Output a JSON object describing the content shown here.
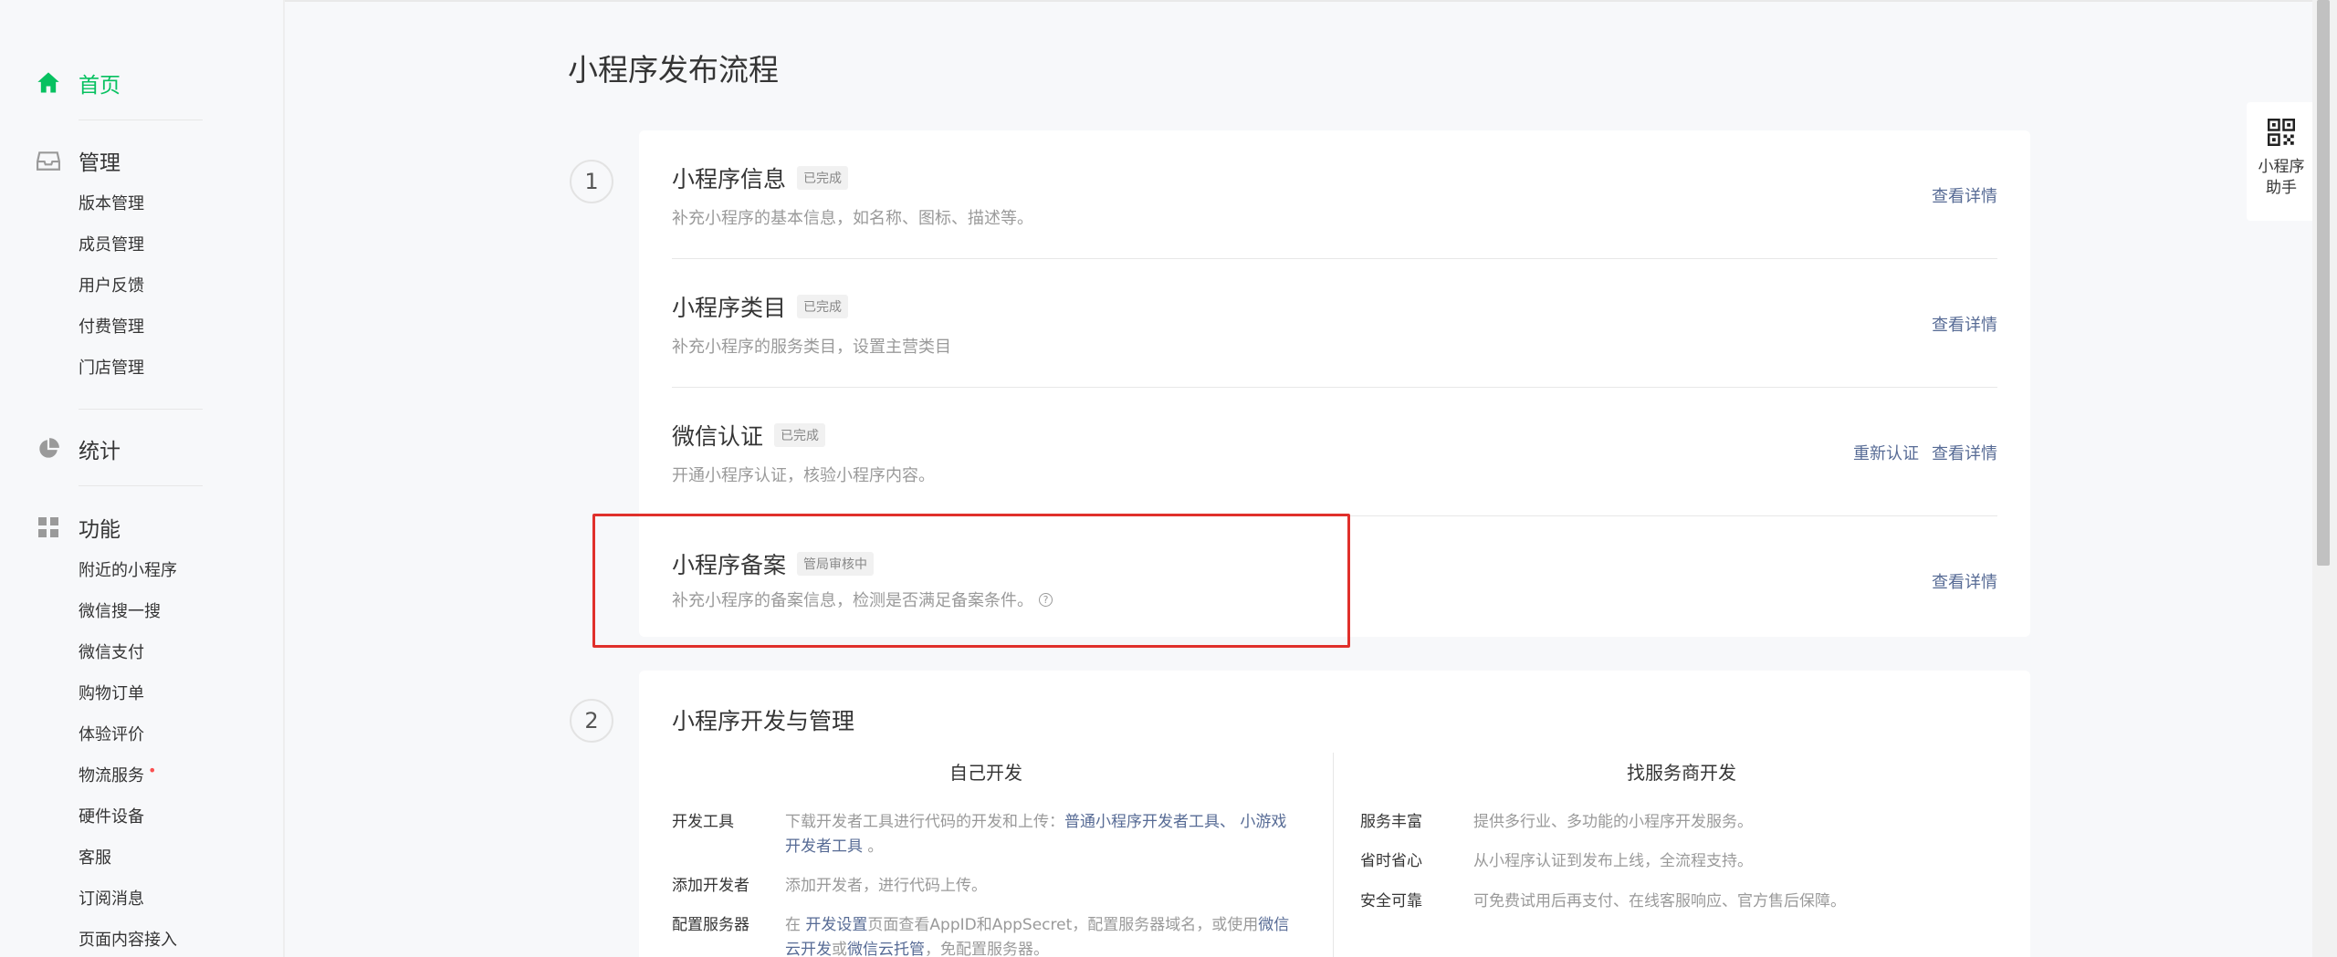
{
  "sidebar": {
    "home": {
      "label": "首页",
      "icon": "home-icon"
    },
    "manage": {
      "label": "管理",
      "icon": "inbox-icon",
      "items": [
        "版本管理",
        "成员管理",
        "用户反馈",
        "付费管理",
        "门店管理"
      ]
    },
    "stats": {
      "label": "统计",
      "icon": "pie-chart-icon"
    },
    "features": {
      "label": "功能",
      "icon": "grid-icon",
      "items": [
        "附近的小程序",
        "微信搜一搜",
        "微信支付",
        "购物订单",
        "体验评价",
        "物流服务",
        "硬件设备",
        "客服",
        "订阅消息",
        "页面内容接入"
      ],
      "new_dot": "•"
    }
  },
  "page": {
    "title": "小程序发布流程"
  },
  "step1": {
    "number": "1",
    "rows": [
      {
        "title": "小程序信息",
        "tag": "已完成",
        "desc": "补充小程序的基本信息，如名称、图标、描述等。",
        "links": [
          "查看详情"
        ]
      },
      {
        "title": "小程序类目",
        "tag": "已完成",
        "desc": "补充小程序的服务类目，设置主营类目",
        "links": [
          "查看详情"
        ]
      },
      {
        "title": "微信认证",
        "tag": "已完成",
        "desc": "开通小程序认证，核验小程序内容。",
        "links": [
          "重新认证",
          "查看详情"
        ]
      },
      {
        "title": "小程序备案",
        "tag": "管局审核中",
        "desc": "补充小程序的备案信息，检测是否满足备案条件。",
        "help": "?",
        "links": [
          "查看详情"
        ]
      }
    ]
  },
  "step2": {
    "number": "2",
    "title": "小程序开发与管理",
    "self_dev": {
      "heading": "自己开发",
      "items": [
        {
          "k": "开发工具",
          "v1": "下载开发者工具进行代码的开发和上传：",
          "a1": "普通小程序开发者工具",
          "sep": "、",
          "a2": "小游戏",
          "a3": "开发者工具",
          "end": "。"
        },
        {
          "k": "添加开发者",
          "v": "添加开发者，进行代码上传。"
        },
        {
          "k": "配置服务器",
          "p1": "在 ",
          "a1": "开发设置",
          "p2": "页面查看AppID和AppSecret，配置服务器域名，或使用",
          "a2": "微信",
          "a3": "云开发",
          "p3": "或",
          "a4": "微信云托管",
          "p4": "，免配置服务器。"
        }
      ]
    },
    "provider_dev": {
      "heading": "找服务商开发",
      "items": [
        {
          "k": "服务丰富",
          "v": "提供多行业、多功能的小程序开发服务。"
        },
        {
          "k": "省时省心",
          "v": "从小程序认证到发布上线，全流程支持。"
        },
        {
          "k": "安全可靠",
          "v": "可免费试用后再支付、在线客服响应、官方售后保障。"
        }
      ]
    }
  },
  "helper": {
    "label": "小程序助手",
    "icon": "qr-code-icon"
  },
  "colors": {
    "accent": "#07c160",
    "link": "#576b95",
    "highlight": "#e0302b"
  }
}
